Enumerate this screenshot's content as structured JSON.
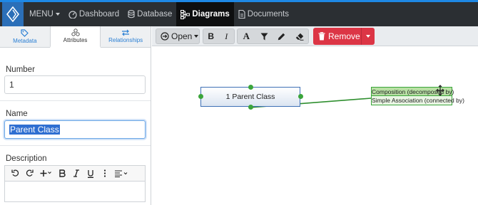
{
  "nav": {
    "menu_label": "MENU",
    "items": [
      {
        "label": "Dashboard",
        "icon": "dashboard-icon"
      },
      {
        "label": "Database",
        "icon": "database-icon"
      },
      {
        "label": "Diagrams",
        "icon": "diagram-icon",
        "active": true
      },
      {
        "label": "Documents",
        "icon": "document-icon"
      }
    ]
  },
  "tabs": [
    {
      "label": "Metadata",
      "icon": "tag-icon"
    },
    {
      "label": "Attributes",
      "icon": "attributes-icon",
      "active": true
    },
    {
      "label": "Relationships",
      "icon": "relationships-icon"
    }
  ],
  "form": {
    "number_label": "Number",
    "number_value": "1",
    "name_label": "Name",
    "name_value": "Parent Class",
    "description_label": "Description"
  },
  "toolbar": {
    "open_label": "Open",
    "bold_label": "B",
    "italic_label": "I",
    "font_label": "A",
    "remove_label": "Remove"
  },
  "canvas": {
    "node_label": "1 Parent Class",
    "menu_items": [
      "Composition (decomposed by)",
      "Simple Association (connected by)"
    ]
  },
  "colors": {
    "accent": "#1e88e5",
    "danger": "#dc3545",
    "connector": "#2f8f2f"
  }
}
